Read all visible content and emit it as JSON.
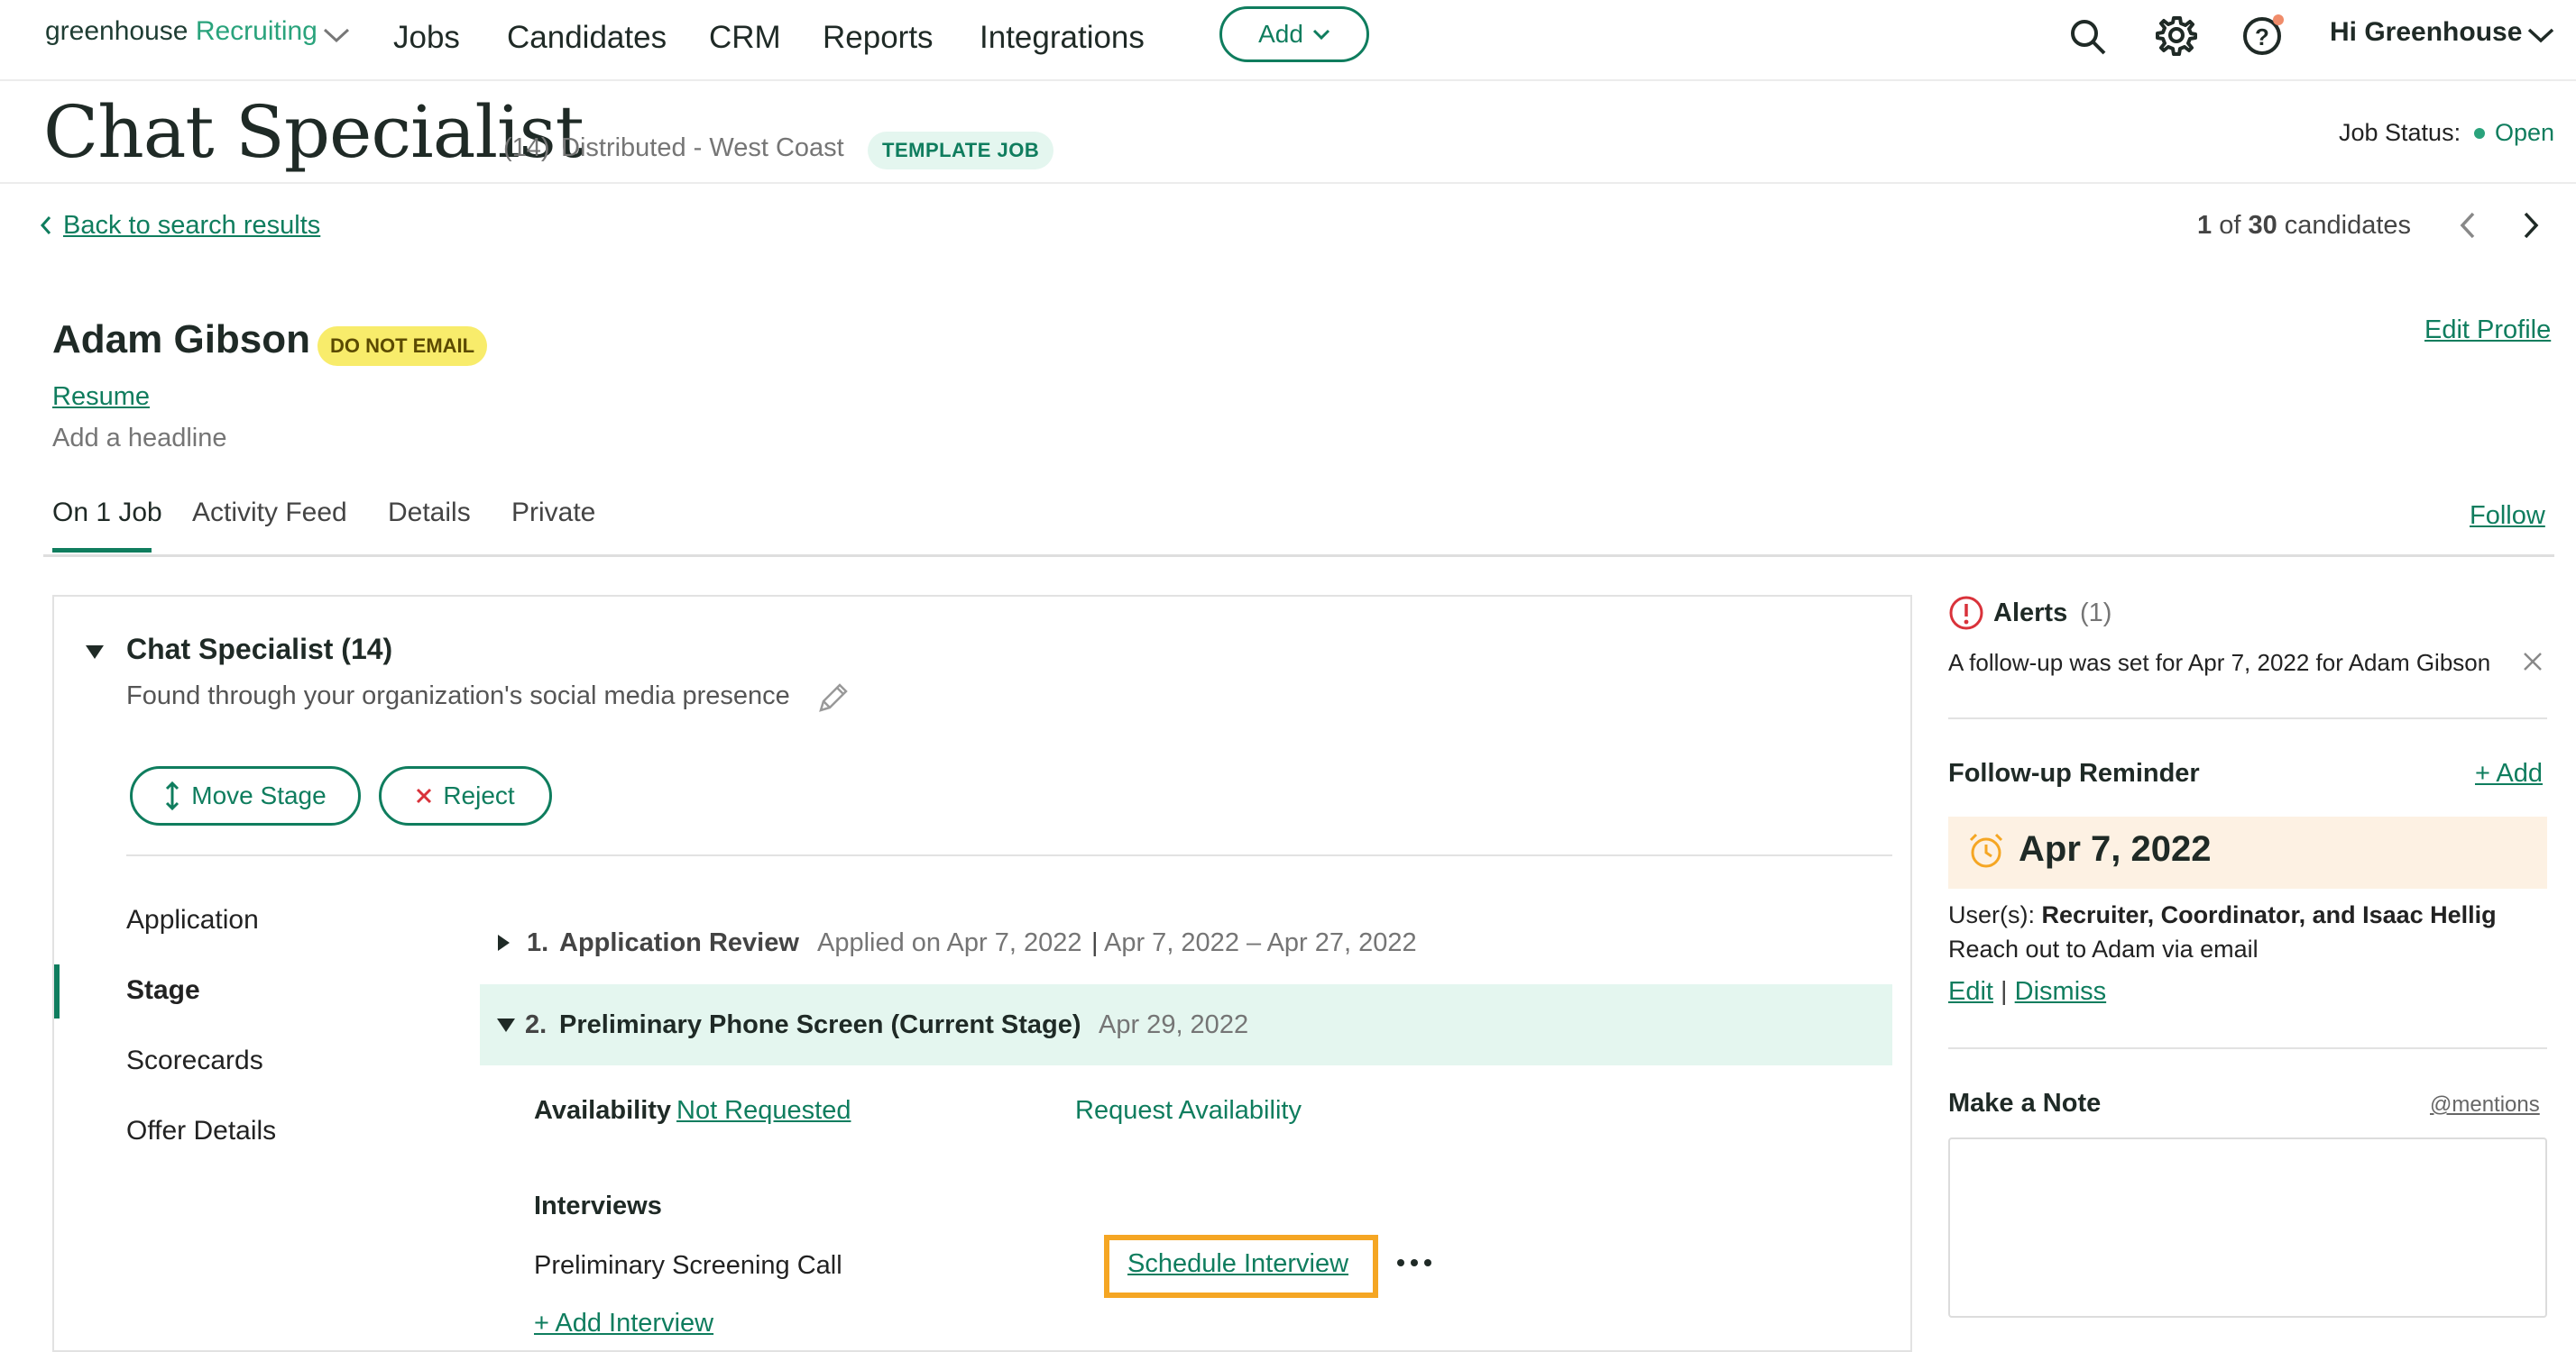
{
  "nav": {
    "logo_main": "greenhouse",
    "logo_sub": "Recruiting",
    "items": [
      "Jobs",
      "Candidates",
      "CRM",
      "Reports",
      "Integrations"
    ],
    "add_label": "Add",
    "greeting": "Hi Greenhouse"
  },
  "job": {
    "title": "Chat Specialist",
    "count": "(14)",
    "location": "Distributed - West Coast",
    "badge": "TEMPLATE JOB",
    "status_label": "Job Status:",
    "status_value": "Open"
  },
  "pager": {
    "back_label": "Back to search results",
    "current": "1",
    "of": "of",
    "total": "30",
    "suffix": "candidates"
  },
  "candidate": {
    "name": "Adam Gibson",
    "badge": "DO NOT EMAIL",
    "resume_label": "Resume",
    "headline_placeholder": "Add a headline",
    "edit_profile": "Edit Profile",
    "follow": "Follow",
    "tabs": [
      "On 1 Job",
      "Activity Feed",
      "Details",
      "Private"
    ]
  },
  "application": {
    "job_title": "Chat Specialist (14)",
    "source": "Found through your organization's social media presence",
    "move_stage": "Move Stage",
    "reject": "Reject",
    "left_nav": [
      "Application",
      "Stage",
      "Scorecards",
      "Offer Details"
    ],
    "stages": [
      {
        "num": "1.",
        "name": "Application Review",
        "meta": "Applied on Apr 7, 2022",
        "range": "Apr 7, 2022 – Apr 27, 2022"
      },
      {
        "num": "2.",
        "name": "Preliminary Phone Screen (Current Stage)",
        "meta": "Apr 29, 2022"
      }
    ],
    "availability_label": "Availability",
    "availability_value": "Not Requested",
    "request_availability": "Request Availability",
    "interviews_label": "Interviews",
    "interview_name": "Preliminary Screening Call",
    "schedule_interview": "Schedule Interview",
    "add_interview": "+ Add Interview"
  },
  "sidebar": {
    "alerts_title": "Alerts",
    "alerts_count": "(1)",
    "alert_text": "A follow-up was set for Apr 7, 2022 for Adam Gibson",
    "followup_title": "Follow-up Reminder",
    "followup_add": "+ Add",
    "reminder_date": "Apr 7, 2022",
    "users_label": "User(s):",
    "users_value": "Recruiter, Coordinator, and Isaac Hellig",
    "reminder_note": "Reach out to Adam via email",
    "edit": "Edit",
    "sep": "|",
    "dismiss": "Dismiss",
    "note_title": "Make a Note",
    "mentions": "@mentions"
  },
  "colors": {
    "accent": "#0f7d5e",
    "highlight": "#f5a623",
    "badge_yellow": "#f8ec6b",
    "current_stage_bg": "#e4f6ef",
    "alert_red": "#d9323a"
  }
}
